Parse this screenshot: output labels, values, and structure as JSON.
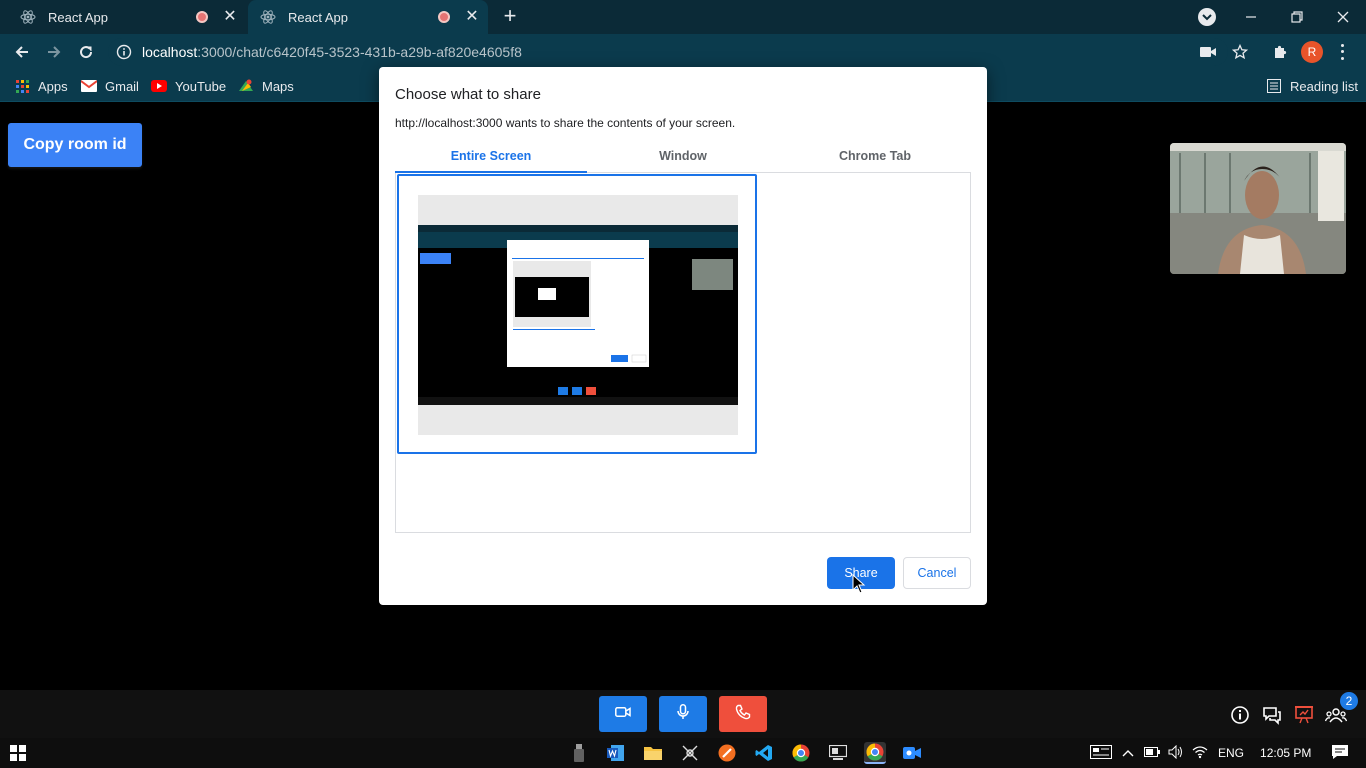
{
  "browser": {
    "tabs": [
      {
        "title": "React App",
        "recording": true,
        "active": false
      },
      {
        "title": "React App",
        "recording": true,
        "active": true
      }
    ],
    "url_host": "localhost",
    "url_path": ":3000/chat/c6420f45-3523-431b-a29b-af820e4605f8",
    "profile_initial": "R",
    "bookmarks": [
      {
        "label": "Apps",
        "icon": "apps-grid-icon"
      },
      {
        "label": "Gmail",
        "icon": "gmail-icon"
      },
      {
        "label": "YouTube",
        "icon": "youtube-icon"
      },
      {
        "label": "Maps",
        "icon": "maps-icon"
      }
    ],
    "reading_list_label": "Reading list"
  },
  "page": {
    "copy_room_label": "Copy room id"
  },
  "dialog": {
    "title": "Choose what to share",
    "subtitle": "http://localhost:3000 wants to share the contents of your screen.",
    "tabs": [
      "Entire Screen",
      "Window",
      "Chrome Tab"
    ],
    "active_tab": "Entire Screen",
    "share_label": "Share",
    "cancel_label": "Cancel"
  },
  "call_controls": {
    "buttons": [
      "camera-icon",
      "microphone-icon",
      "end-call-icon"
    ],
    "participants_badge": "2",
    "colors": {
      "primary": "#1e7be6",
      "danger": "#ef4f3c"
    }
  },
  "taskbar": {
    "language": "ENG",
    "time": "12:05 PM"
  }
}
